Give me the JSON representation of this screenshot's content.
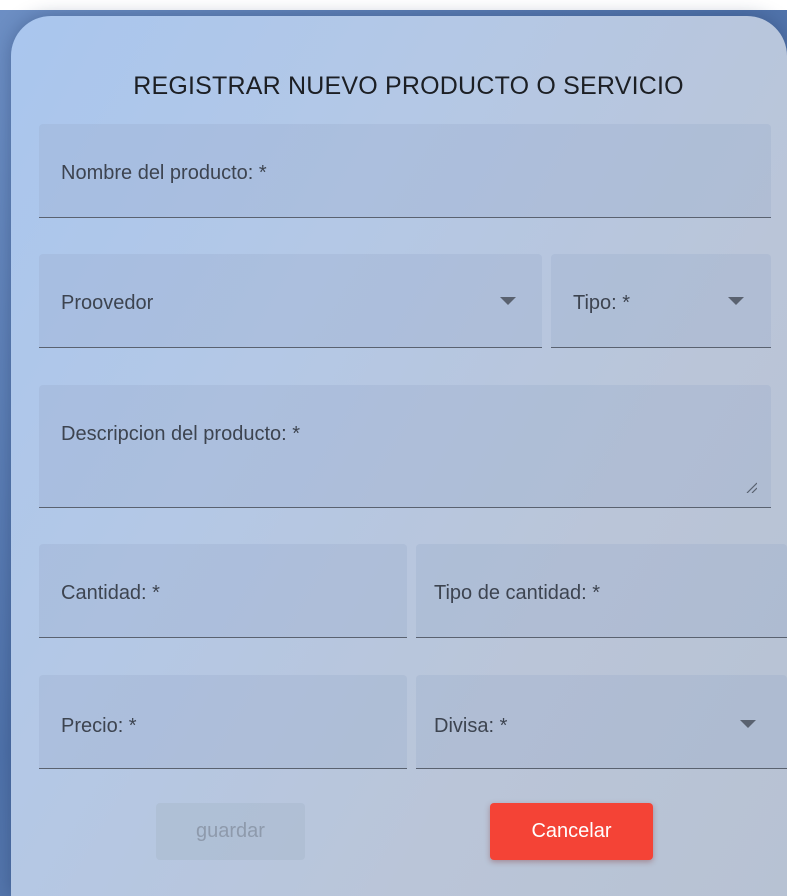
{
  "form": {
    "title": "REGISTRAR NUEVO PRODUCTO O SERVICIO",
    "fields": {
      "nombre": {
        "label": "Nombre del producto: *"
      },
      "proveedor": {
        "label": "Proovedor"
      },
      "tipo": {
        "label": "Tipo: *"
      },
      "descripcion": {
        "label": "Descripcion del producto: *"
      },
      "cantidad": {
        "label": "Cantidad: *"
      },
      "tipo_cantidad": {
        "label": "Tipo de cantidad: *"
      },
      "precio": {
        "label": "Precio: *"
      },
      "divisa": {
        "label": "Divisa: *"
      }
    },
    "buttons": {
      "save_label": "guardar",
      "cancel_label": "Cancelar"
    }
  },
  "colors": {
    "cancel_button": "#f44336",
    "save_button_disabled": "#aab9cd",
    "field_underline": "#5a6270"
  },
  "icons": {
    "dropdown": "chevron-down-icon",
    "resize": "resize-handle-icon"
  }
}
